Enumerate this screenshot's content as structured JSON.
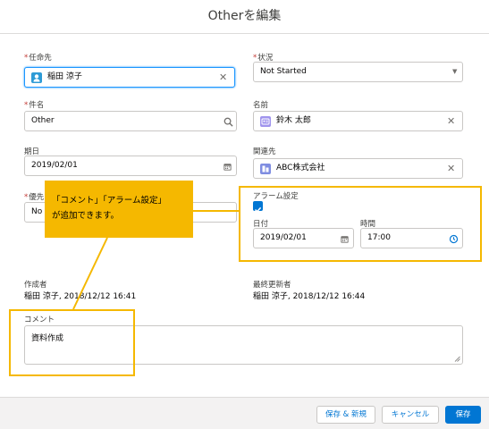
{
  "header": {
    "title": "Otherを編集"
  },
  "form": {
    "assignee": {
      "label": "任命先",
      "value": "稲田 涼子"
    },
    "status": {
      "label": "状況",
      "value": "Not Started"
    },
    "subject": {
      "label": "件名",
      "value": "Other"
    },
    "name": {
      "label": "名前",
      "value": "鈴木 太郎"
    },
    "due_date": {
      "label": "期日",
      "value": "2019/02/01"
    },
    "related": {
      "label": "関連先",
      "value": "ABC株式会社"
    },
    "priority": {
      "label": "優先",
      "value": "No"
    },
    "alarm": {
      "label": "アラーム設定",
      "checked": true,
      "date_label": "日付",
      "date_value": "2019/02/01",
      "time_label": "時間",
      "time_value": "17:00"
    },
    "created_by": {
      "label": "作成者",
      "value": "稲田 涼子, 2018/12/12 16:41"
    },
    "modified_by": {
      "label": "最終更新者",
      "value": "稲田 涼子, 2018/12/12 16:44"
    },
    "comment": {
      "label": "コメント",
      "value": "資料作成"
    }
  },
  "annotation": {
    "line1": "「コメント」「アラーム設定」",
    "line2": "が追加できます。",
    "color": "#f5b800"
  },
  "footer": {
    "save_new": "保存 & 新規",
    "cancel": "キャンセル",
    "save": "保存"
  },
  "colors": {
    "brand": "#0176d3",
    "user_icon": "#2e9bd6",
    "contact_icon": "#a094ed",
    "account_icon": "#7f8de1"
  }
}
